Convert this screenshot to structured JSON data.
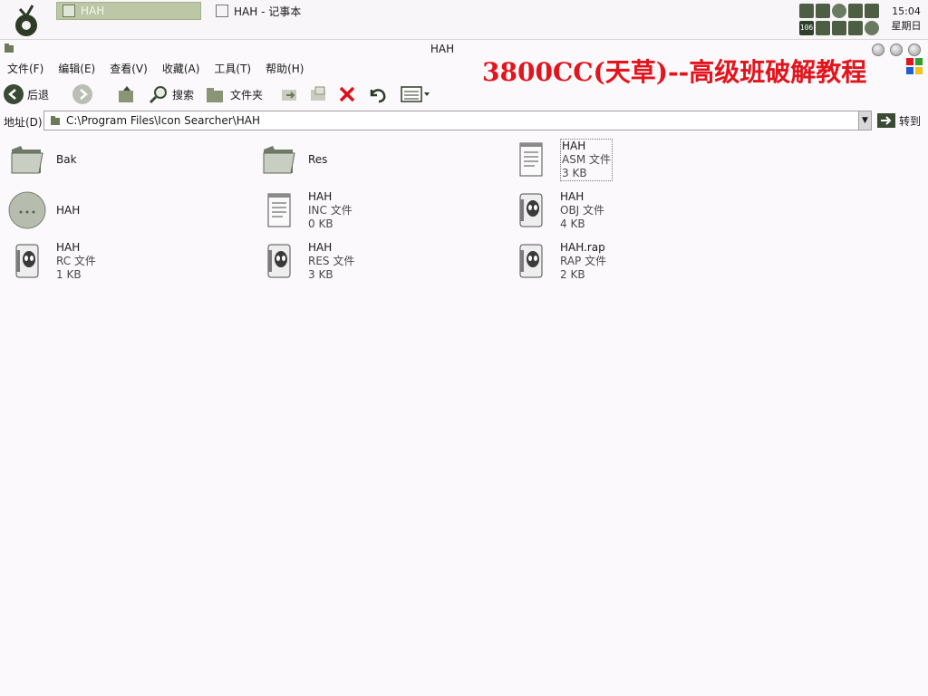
{
  "taskbar": {
    "active_task": "HAH",
    "inactive_task": "HAH - 记事本",
    "tray_badge": "106",
    "clock_time": "15:04",
    "clock_day": "星期日"
  },
  "window": {
    "title": "HAH",
    "watermark": "3800CC(天草)--高级班破解教程"
  },
  "menu": [
    "文件(F)",
    "编辑(E)",
    "查看(V)",
    "收藏(A)",
    "工具(T)",
    "帮助(H)"
  ],
  "toolbar": {
    "back_label": "后退",
    "search_label": "搜索",
    "folders_label": "文件夹"
  },
  "address": {
    "label": "地址(D)",
    "value": "C:\\Program Files\\Icon Searcher\\HAH",
    "go_label": "转到"
  },
  "files": [
    {
      "name": "Bak",
      "type": "",
      "size": "",
      "icon": "folder-icon"
    },
    {
      "name": "Res",
      "type": "",
      "size": "",
      "icon": "folder-icon"
    },
    {
      "name": "HAH",
      "type": "ASM 文件",
      "size": "3 KB",
      "icon": "text-document-icon"
    },
    {
      "name": "HAH",
      "type": "",
      "size": "",
      "icon": "app-circle-icon"
    },
    {
      "name": "HAH",
      "type": "INC 文件",
      "size": "0 KB",
      "icon": "text-document-icon"
    },
    {
      "name": "HAH",
      "type": "OBJ 文件",
      "size": "4 KB",
      "icon": "alien-file-icon"
    },
    {
      "name": "HAH",
      "type": "RC 文件",
      "size": "1 KB",
      "icon": "alien-file-icon"
    },
    {
      "name": "HAH",
      "type": "RES 文件",
      "size": "3 KB",
      "icon": "alien-file-icon"
    },
    {
      "name": "HAH.rap",
      "type": "RAP 文件",
      "size": "2 KB",
      "icon": "alien-file-icon"
    }
  ]
}
